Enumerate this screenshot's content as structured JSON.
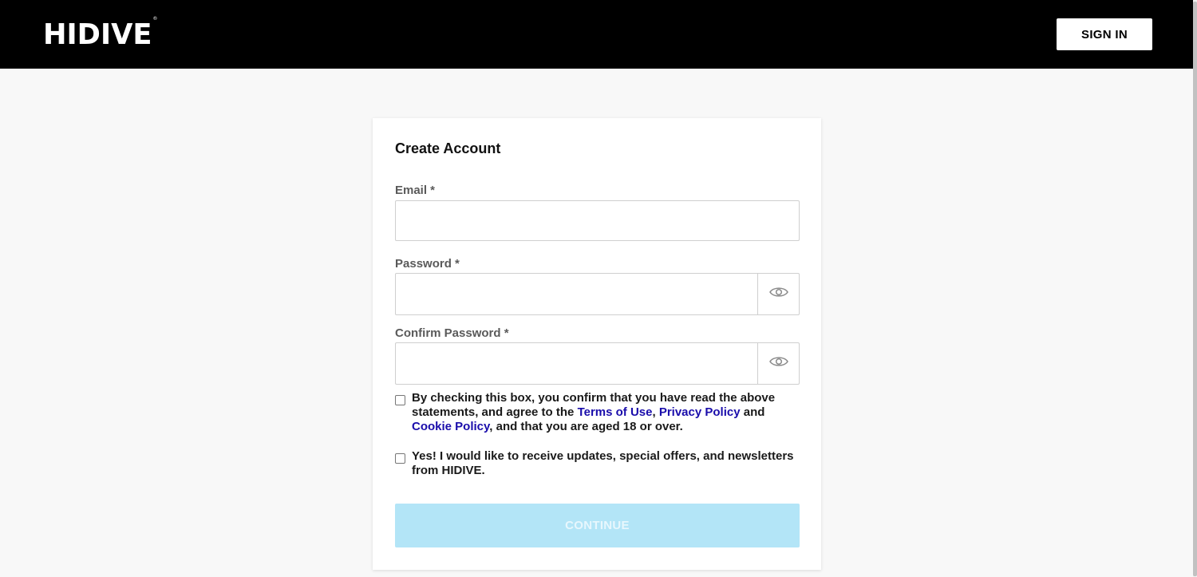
{
  "header": {
    "logo_text": "HIDIVE",
    "logo_mark": "®",
    "sign_in_label": "SIGN IN",
    "background_color": "#000000"
  },
  "form": {
    "title": "Create Account",
    "email": {
      "label": "Email *",
      "value": "",
      "placeholder": ""
    },
    "password": {
      "label": "Password *",
      "value": "",
      "placeholder": "",
      "toggle_icon": "eye-icon"
    },
    "confirm_password": {
      "label": "Confirm Password *",
      "value": "",
      "placeholder": "",
      "toggle_icon": "eye-icon"
    },
    "terms_checkbox": {
      "checked": false,
      "text_before": "By checking this box, you confirm that you have read the above statements, and agree to the ",
      "terms_link": "Terms of Use",
      "separator": ", ",
      "privacy_link": "Privacy Policy",
      "and_text": " and ",
      "cookie_link": "Cookie Policy",
      "text_after": ", and that you are aged 18 or over."
    },
    "newsletter_checkbox": {
      "checked": false,
      "text": "Yes! I would like to receive updates, special offers, and newsletters from HIDIVE."
    },
    "continue_label": "CONTINUE",
    "continue_enabled": false,
    "continue_color": "#b3e5f7",
    "link_color": "#1a0dab"
  }
}
